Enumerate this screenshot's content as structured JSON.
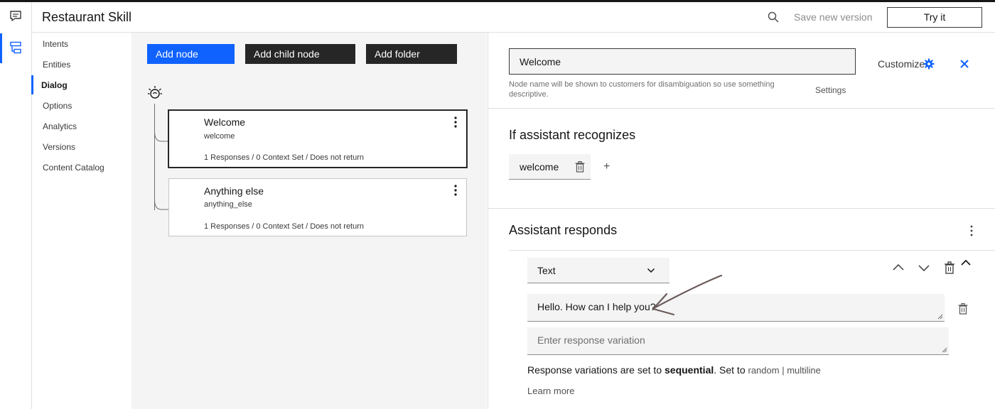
{
  "app": {
    "title": "Restaurant Skill"
  },
  "header": {
    "save_label": "Save new version",
    "try_label": "Try it"
  },
  "rail": {
    "icons": [
      "chat-icon",
      "dialog-tree-icon"
    ]
  },
  "nav": {
    "items": [
      {
        "label": "Intents",
        "active": false
      },
      {
        "label": "Entities",
        "active": false
      },
      {
        "label": "Dialog",
        "active": true
      },
      {
        "label": "Options",
        "active": false
      },
      {
        "label": "Analytics",
        "active": false
      },
      {
        "label": "Versions",
        "active": false
      },
      {
        "label": "Content Catalog",
        "active": false
      }
    ]
  },
  "toolbar": {
    "add_node": "Add node",
    "add_child": "Add child node",
    "add_folder": "Add folder"
  },
  "nodes": [
    {
      "title": "Welcome",
      "id": "welcome",
      "meta": "1 Responses / 0 Context Set / Does not return",
      "selected": true
    },
    {
      "title": "Anything else",
      "id": "anything_else",
      "meta": "1 Responses / 0 Context Set / Does not return",
      "selected": false
    }
  ],
  "panel": {
    "node_name": "Welcome",
    "hint": "Node name will be shown to customers for disambiguation so use something descriptive.",
    "customize": "Customize",
    "settings": "Settings",
    "recognizes_title": "If assistant recognizes",
    "condition": "welcome",
    "plus": "+",
    "responds_title": "Assistant responds",
    "response_type": "Text",
    "response_1": "Hello. How can I help you?",
    "response_placeholder": "Enter response variation",
    "variation_prefix": "Response variations are set to ",
    "variation_mode": "sequential",
    "variation_mid": ". Set to ",
    "variation_opt1": "random",
    "variation_sep": " | ",
    "variation_opt2": "multiline",
    "learn_more": "Learn more"
  },
  "colors": {
    "accent": "#0f62fe",
    "dark": "#262626",
    "field": "#f4f4f4",
    "annotation": "#6b5a5a"
  }
}
